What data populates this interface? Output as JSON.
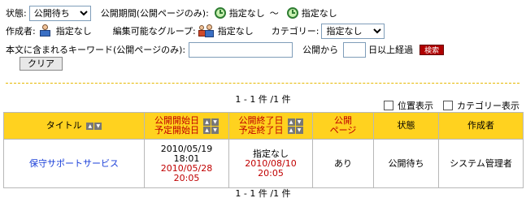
{
  "filters": {
    "status_label": "状態:",
    "status_value": "公開待ち",
    "period_label": "公開期間(公開ページのみ):",
    "period_from": "指定なし",
    "period_sep": "〜",
    "period_to": "指定なし",
    "creator_label": "作成者:",
    "creator_value": "指定なし",
    "group_label": "編集可能なグループ:",
    "group_value": "指定なし",
    "category_label": "カテゴリー:",
    "category_value": "指定なし",
    "keyword_label": "本文に含まれるキーワード(公開ページのみ):",
    "keyword_value": "",
    "public_from_label": "公開から",
    "days_value": "",
    "days_suffix": "日以上経過",
    "search_button": "検索",
    "clear_button": "クリア"
  },
  "results": {
    "count_top": "1 - 1 件 /1 件",
    "count_bottom": "1 - 1 件 /1 件",
    "option_position": "位置表示",
    "option_category": "カテゴリー表示"
  },
  "table": {
    "headers": {
      "title": "タイトル",
      "start": "公開開始日",
      "start_planned": "予定開始日",
      "end": "公開終了日",
      "end_planned": "予定終了日",
      "public_page_1": "公開",
      "public_page_2": "ページ",
      "status": "状態",
      "creator": "作成者"
    },
    "rows": [
      {
        "title": "保守サポートサービス",
        "start_date": "2010/05/19",
        "start_time": "18:01",
        "planned_start_date": "2010/05/28",
        "planned_start_time": "20:05",
        "end_value": "指定なし",
        "planned_end_date": "2010/08/10",
        "planned_end_time": "20:05",
        "public_page": "あり",
        "status": "公開待ち",
        "creator": "システム管理者"
      }
    ]
  },
  "colors": {
    "header_bg": "#ffd21f",
    "accent_red": "#c00000",
    "link_blue": "#1a3fd9",
    "search_button_bg": "#b00000"
  }
}
